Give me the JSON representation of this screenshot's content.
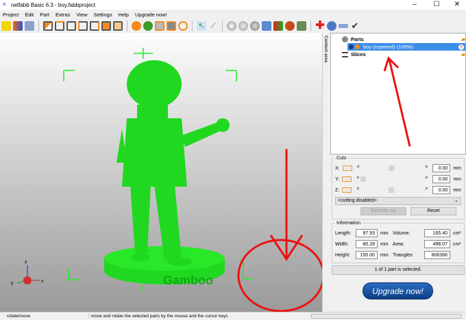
{
  "window": {
    "title": "netfabb Basic 6.3 - boy.fabbproject"
  },
  "menu": [
    "Project",
    "Edit",
    "Part",
    "Extras",
    "View",
    "Settings",
    "Help",
    "Upgrade now!"
  ],
  "context_area_label": "Context area",
  "tree": {
    "parts": "Parts",
    "part": "boy (repaired) (100%)",
    "slices": "Slices"
  },
  "cuts": {
    "title": "Cuts",
    "x_label": "X:",
    "y_label": "Y:",
    "z_label": "Z:",
    "x": "0.00",
    "y": "0.00",
    "z": "0.00",
    "unit": "mm",
    "lt": "<",
    "gt": ">",
    "mode": "<cutting disabled>",
    "execute": "Execute cut",
    "reset": "Reset"
  },
  "info": {
    "title": "Information",
    "length_label": "Length:",
    "length": "97.93",
    "width_label": "Width:",
    "width": "80.28",
    "height_label": "Height:",
    "height": "150.00",
    "mm": "mm",
    "volume_label": "Volume:",
    "volume": "165.40",
    "area_label": "Area:",
    "area": "498.07",
    "cm3": "cm³",
    "cm2": "cm²",
    "triangles_label": "Triangles:",
    "triangles": "806366"
  },
  "selection_status": "1 of 1 part is selected.",
  "upgrade_button": "Upgrade now!",
  "model_text": "Gamboo",
  "axes": {
    "x": "x",
    "y": "y",
    "z": "z"
  },
  "statusbar": {
    "mode": "rotate/move",
    "hint": "move and rotate the selected parts by the mouse and the cursor keys"
  },
  "colors": {
    "model": "#22dd22",
    "selection": "#3a8ee6",
    "annotation": "#ee1111"
  }
}
